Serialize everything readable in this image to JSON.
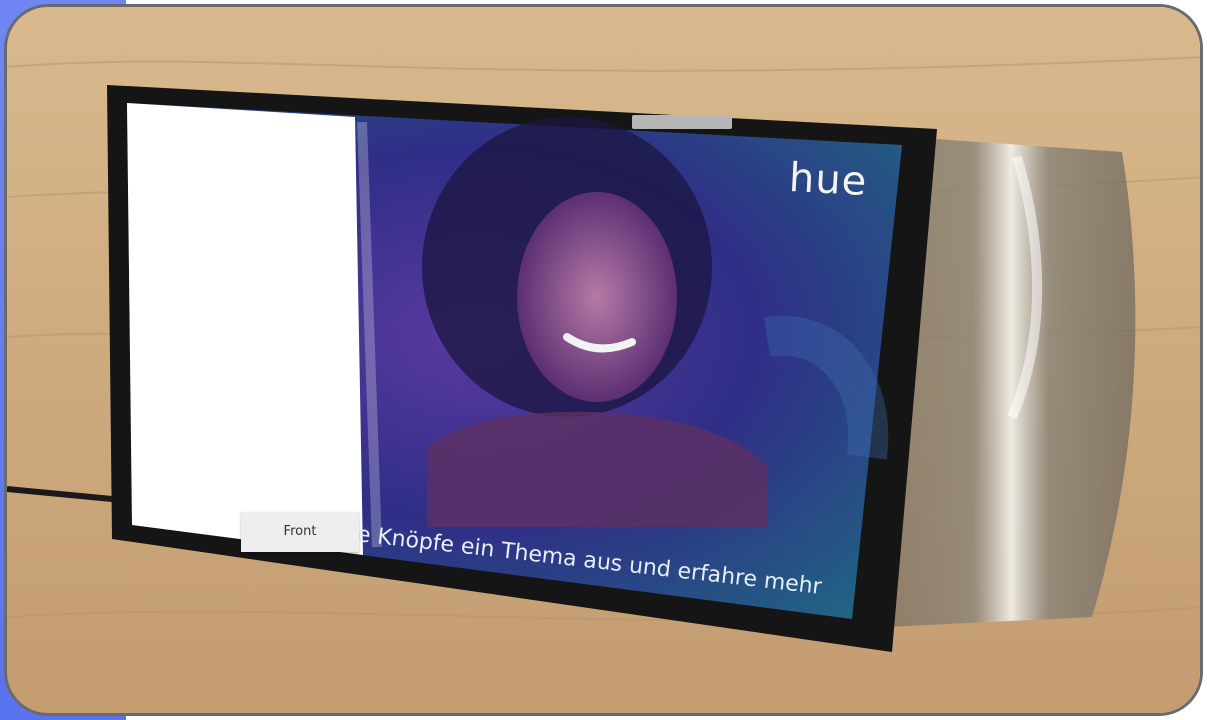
{
  "screen": {
    "brand": "hue",
    "caption": "e Knöpfe ein Thema aus und erfahre mehr"
  },
  "label": {
    "text": "Front"
  },
  "colors": {
    "accent": "#5a73ee",
    "frame_border": "#6a6a6a",
    "table_wood": "#c9a57a",
    "tablet_bezel": "#151515",
    "screen_teal": "#1d5f74",
    "screen_purple": "#4a2a86"
  }
}
